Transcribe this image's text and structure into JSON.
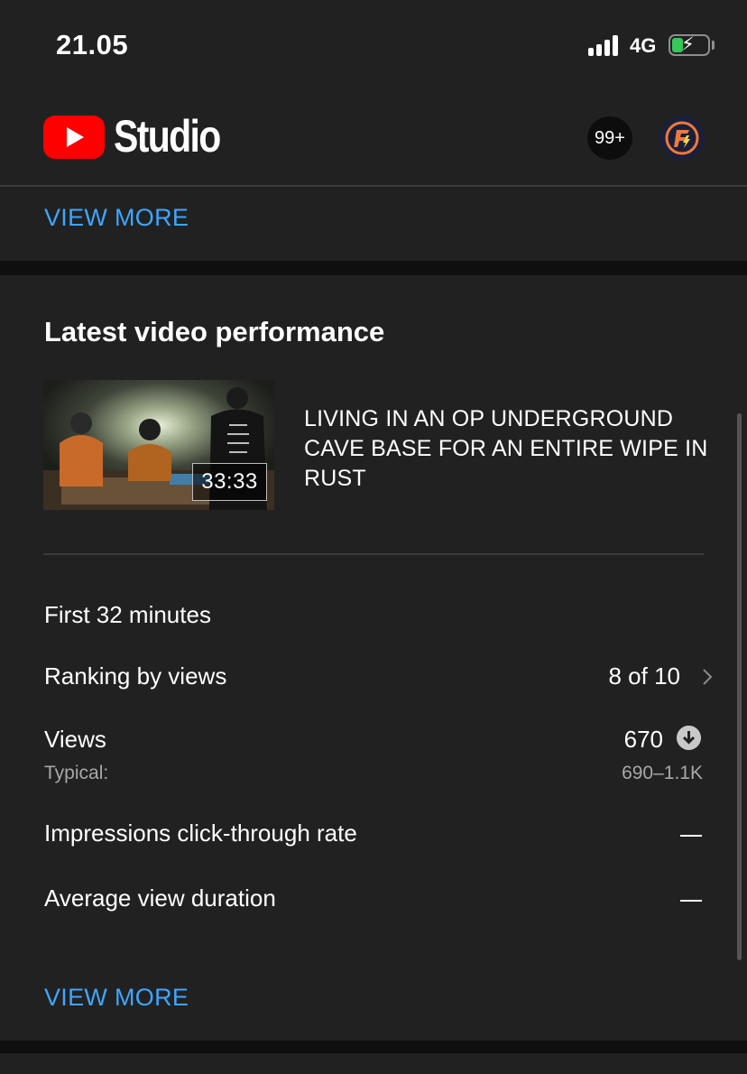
{
  "status_bar": {
    "time": "21.05",
    "network": "4G",
    "icons": [
      "cellular-signal-icon",
      "battery-charging-icon"
    ],
    "battery_color": "#34c759"
  },
  "header": {
    "logo_text": "Studio",
    "logo_icon": "youtube-play-icon",
    "notifications_badge": "99+",
    "avatar_icon": "channel-avatar"
  },
  "top_section": {
    "view_more_label": "VIEW MORE"
  },
  "latest_video": {
    "heading": "Latest video performance",
    "video_title": "LIVING IN AN OP UNDERGROUND CAVE BASE FOR AN ENTIRE WIPE IN RUST",
    "duration": "33:33",
    "period_label": "First 32 minutes",
    "ranking": {
      "label": "Ranking by views",
      "value": "8 of 10"
    },
    "views": {
      "label": "Views",
      "value": "670",
      "typical_label": "Typical:",
      "typical_value": "690–1.1K",
      "trend_icon": "arrow-down-circle-icon"
    },
    "ctr": {
      "label": "Impressions click-through rate",
      "value": "—"
    },
    "avg_duration": {
      "label": "Average view duration",
      "value": "—"
    },
    "view_more_label": "VIEW MORE"
  },
  "colors": {
    "background": "#212121",
    "link": "#3ea6ff",
    "brand_red": "#ff0000",
    "muted_text": "#a8a8a8"
  }
}
